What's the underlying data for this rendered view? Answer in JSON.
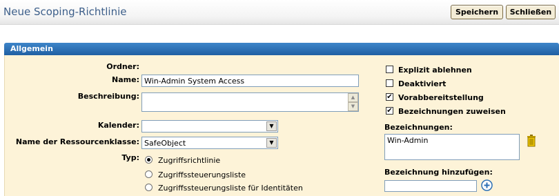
{
  "header": {
    "title": "Neue Scoping-Richtlinie",
    "save_label": "Speichern",
    "close_label": "Schließen"
  },
  "section": {
    "title": "Allgemein"
  },
  "form": {
    "folder_label": "Ordner:",
    "name_label": "Name:",
    "name_value": "Win-Admin System Access",
    "description_label": "Beschreibung:",
    "description_value": "",
    "calendar_label": "Kalender:",
    "calendar_value": "",
    "resource_class_label": "Name der Ressourcenklasse:",
    "resource_class_value": "SafeObject",
    "type_label": "Typ:",
    "type_options": [
      {
        "label": "Zugriffsrichtlinie",
        "selected": true
      },
      {
        "label": "Zugriffssteuerungsliste",
        "selected": false
      },
      {
        "label": "Zugriffssteuerungsliste für Identitäten",
        "selected": false
      }
    ]
  },
  "options": {
    "checkboxes": [
      {
        "label": "Explizit ablehnen",
        "checked": false
      },
      {
        "label": "Deaktiviert",
        "checked": false
      },
      {
        "label": "Vorabbereitstellung",
        "checked": true
      },
      {
        "label": "Bezeichnungen zuweisen",
        "checked": true
      }
    ],
    "labels_heading": "Bezeichnungen:",
    "labels_list": [
      "Win-Admin"
    ],
    "add_label_heading": "Bezeichnung hinzufügen:",
    "add_label_value": ""
  },
  "colors": {
    "title": "#3d5f8a",
    "section_header": "#2a6db3",
    "form_background": "#fdf3d8",
    "button_background": "#f3ecd6"
  },
  "icons": {
    "trash": "trash-icon",
    "add": "plus-circle-icon",
    "dropdown": "chevron-down-icon"
  }
}
